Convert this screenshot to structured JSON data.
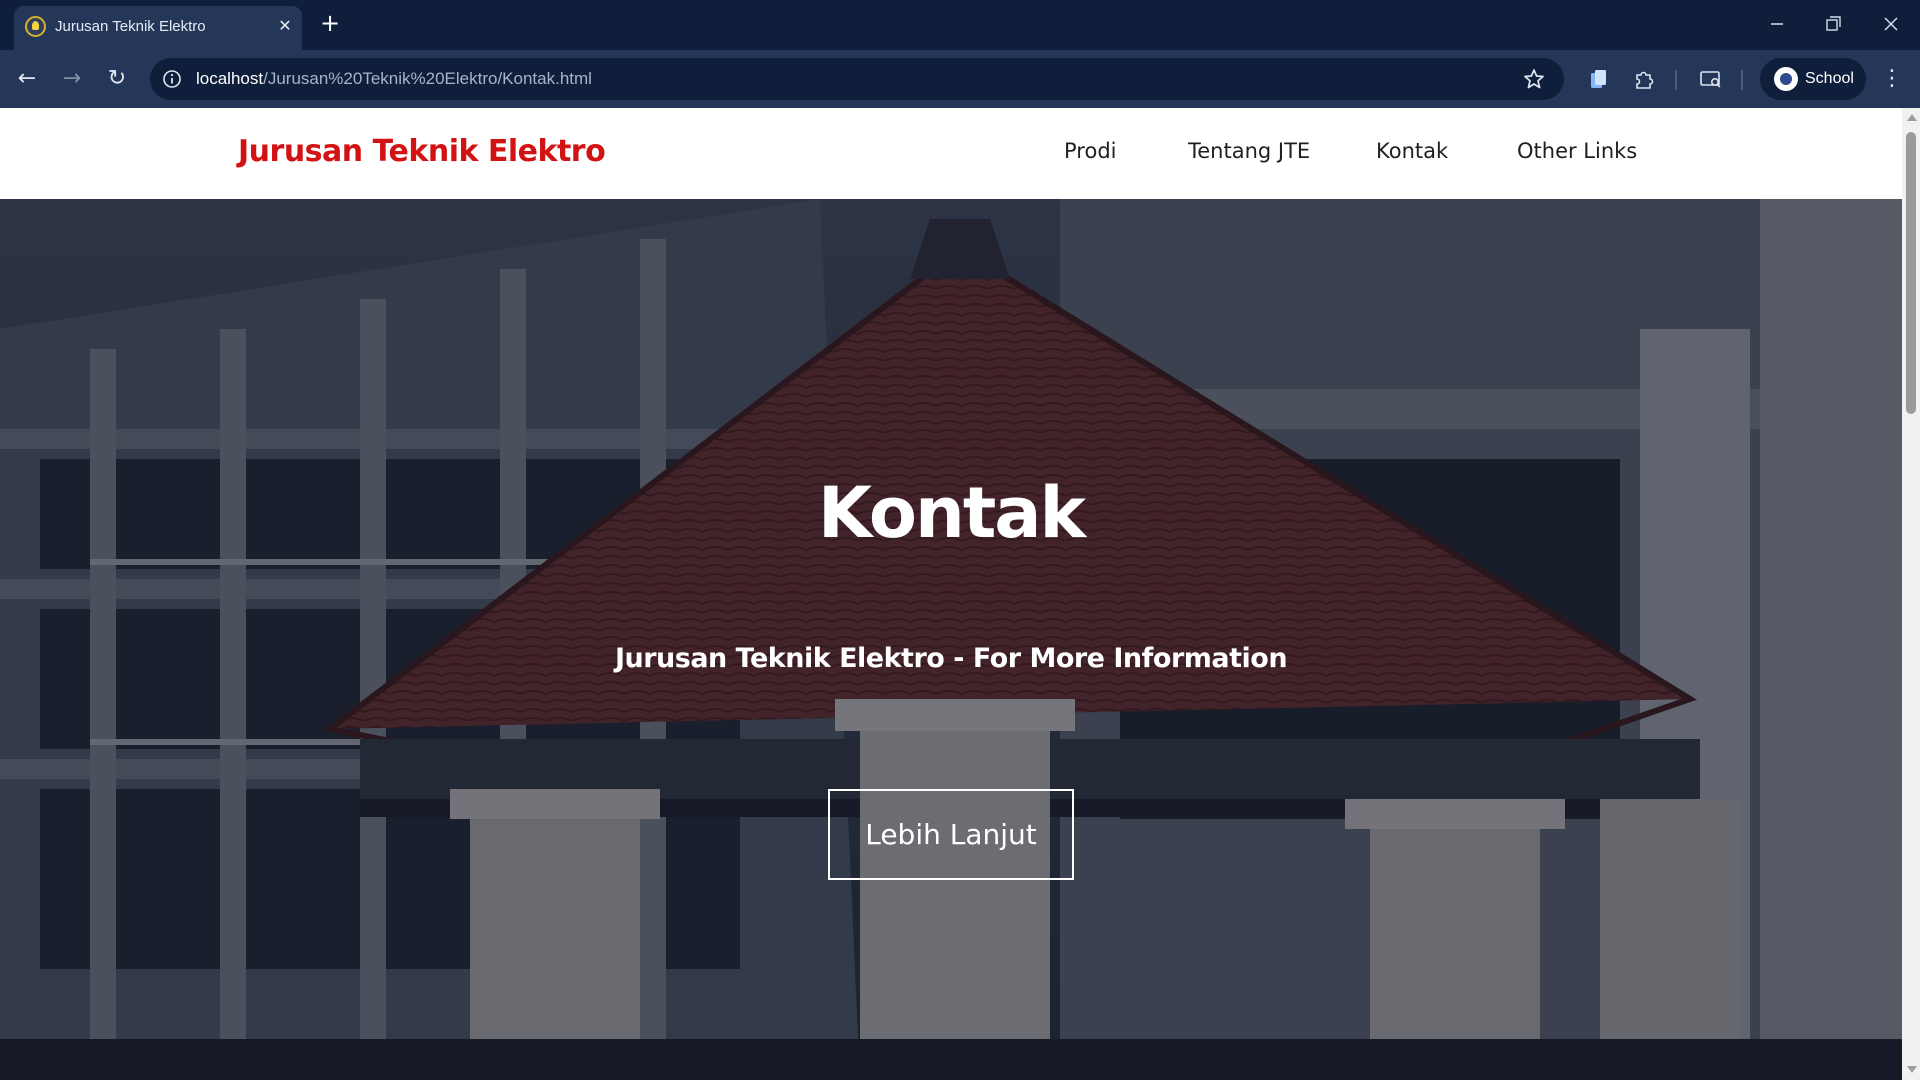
{
  "browser": {
    "tab_title": "Jurusan Teknik Elektro",
    "url_host": "localhost",
    "url_path": "/Jurusan%20Teknik%20Elektro/Kontak.html",
    "profile_label": "School"
  },
  "site": {
    "brand": "Jurusan Teknik Elektro",
    "nav": {
      "prodi": "Prodi",
      "tentang": "Tentang JTE",
      "kontak": "Kontak",
      "other": "Other Links"
    }
  },
  "hero": {
    "title": "Kontak",
    "subtitle": "Jurusan Teknik Elektro - For More Information",
    "cta_label": "Lebih Lanjut"
  },
  "colors": {
    "brand_red": "#d31313",
    "chrome_dark": "#0f1f3b",
    "chrome_toolbar": "#243758",
    "back_to_top": "#e3121c"
  }
}
